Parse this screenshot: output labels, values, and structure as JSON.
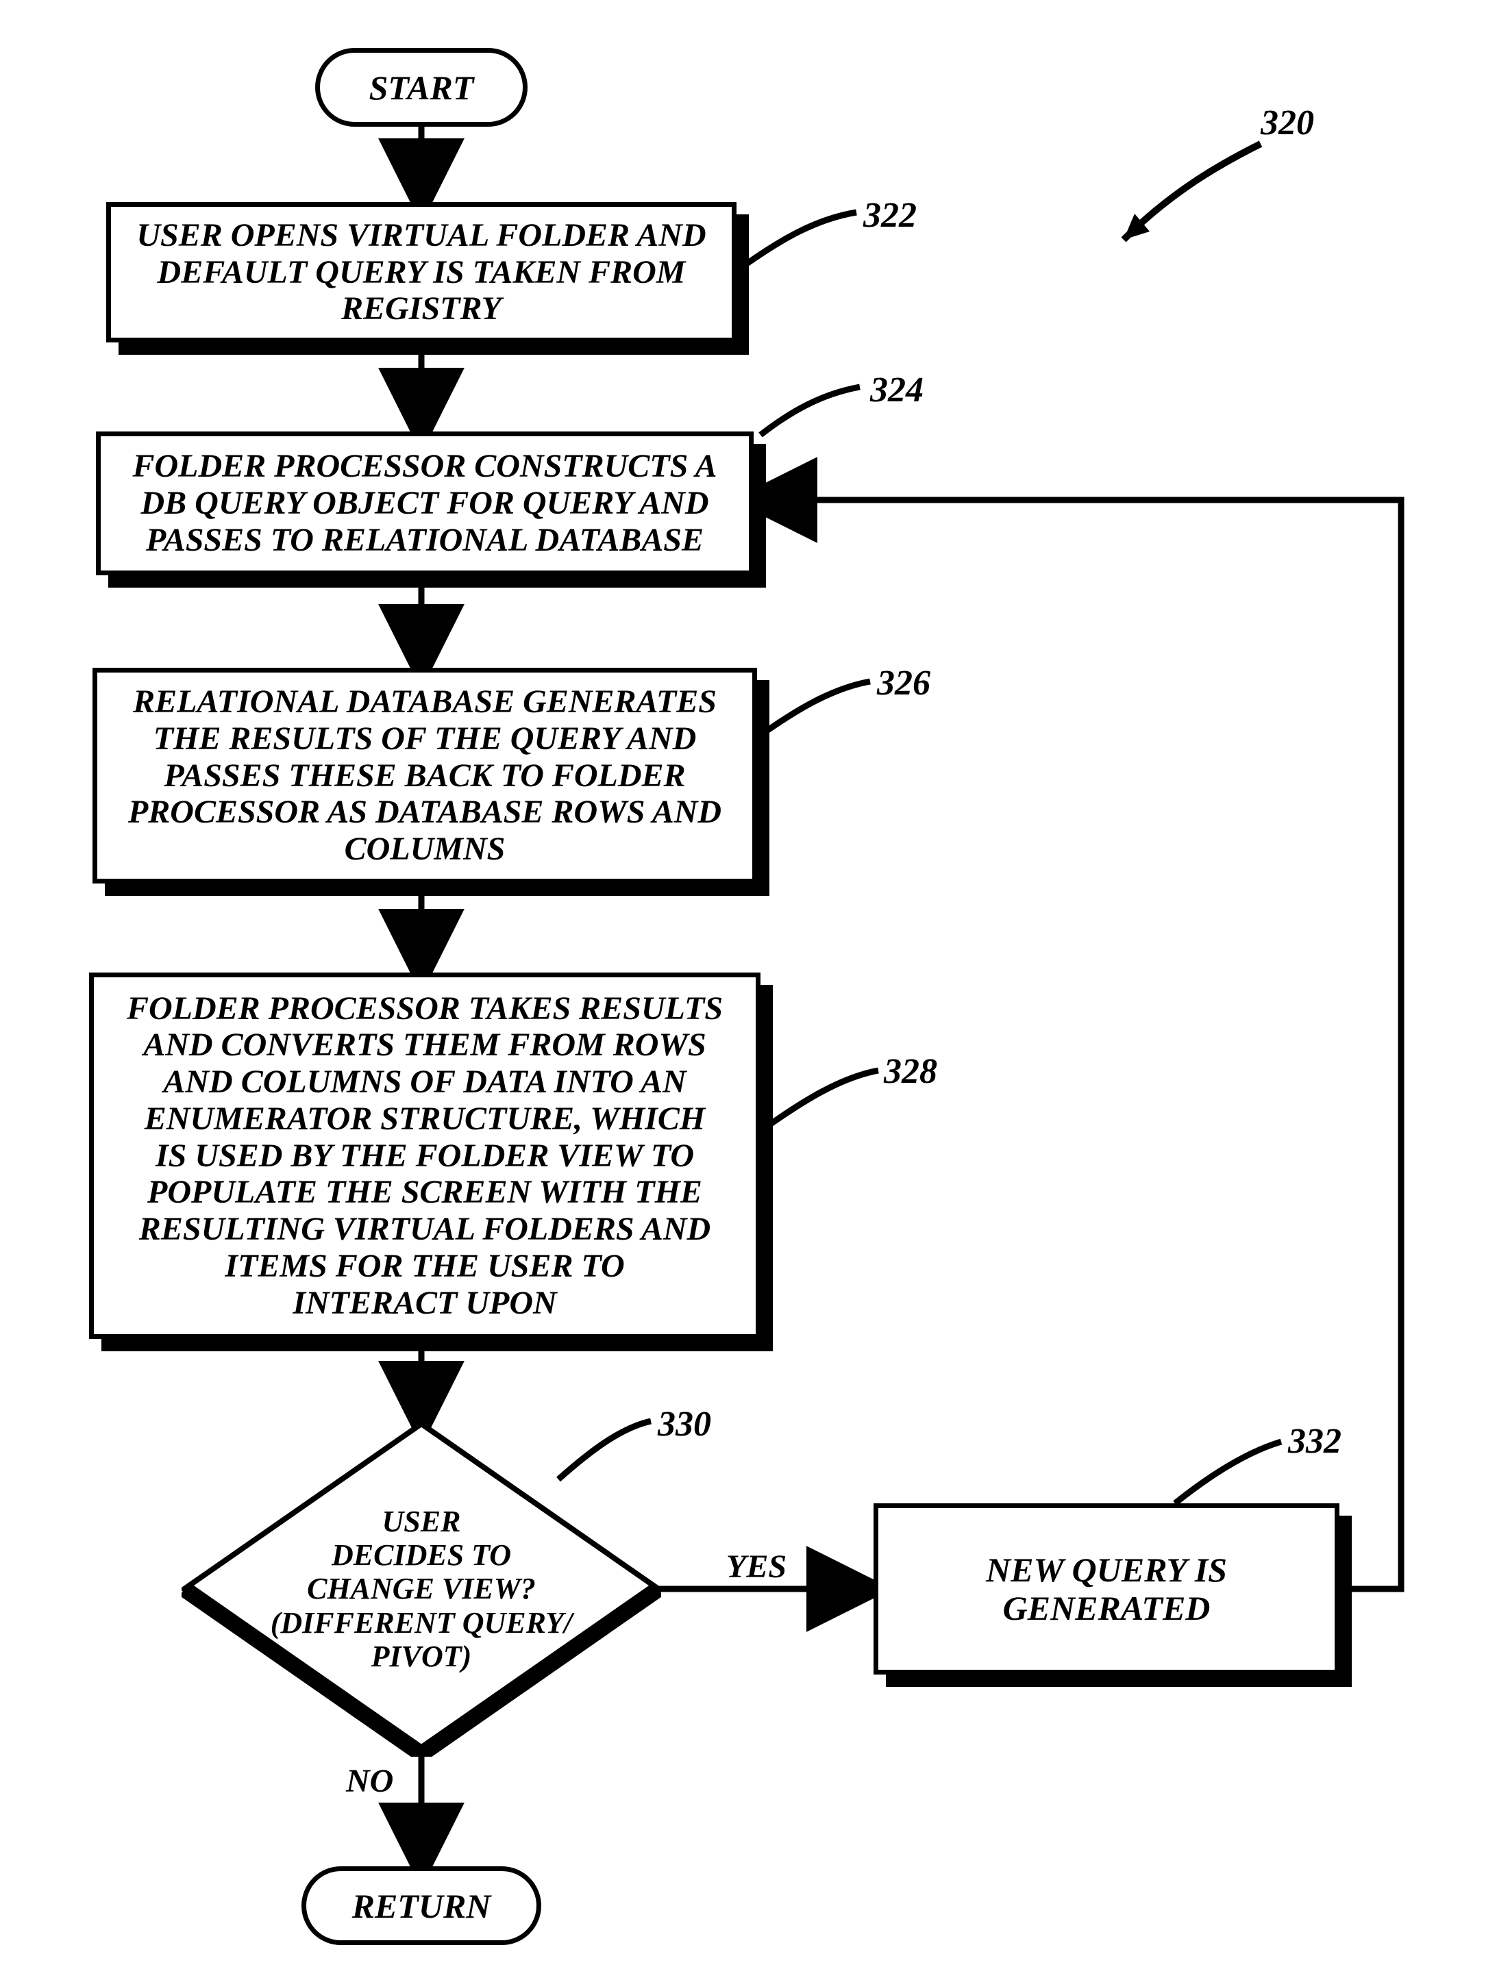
{
  "chart_data": {
    "type": "flowchart",
    "diagram_ref": "320",
    "nodes": [
      {
        "id": "start",
        "shape": "terminator",
        "text": "START"
      },
      {
        "id": "n322",
        "shape": "process",
        "ref": "322",
        "text": "USER OPENS VIRTUAL FOLDER AND DEFAULT QUERY IS TAKEN FROM REGISTRY"
      },
      {
        "id": "n324",
        "shape": "process",
        "ref": "324",
        "text": "FOLDER PROCESSOR CONSTRUCTS A DB QUERY OBJECT FOR QUERY AND PASSES TO RELATIONAL DATABASE"
      },
      {
        "id": "n326",
        "shape": "process",
        "ref": "326",
        "text": "RELATIONAL DATABASE GENERATES THE RESULTS OF THE QUERY AND PASSES THESE BACK TO FOLDER PROCESSOR AS DATABASE ROWS AND COLUMNS"
      },
      {
        "id": "n328",
        "shape": "process",
        "ref": "328",
        "text": "FOLDER PROCESSOR TAKES RESULTS AND CONVERTS THEM FROM ROWS AND COLUMNS OF DATA INTO AN ENUMERATOR STRUCTURE, WHICH IS USED BY THE FOLDER VIEW TO POPULATE THE SCREEN WITH THE RESULTING VIRTUAL FOLDERS AND ITEMS FOR THE USER TO INTERACT UPON"
      },
      {
        "id": "n330",
        "shape": "decision",
        "ref": "330",
        "text": "USER DECIDES TO CHANGE VIEW? (DIFFERENT QUERY/PIVOT)"
      },
      {
        "id": "n332",
        "shape": "process",
        "ref": "332",
        "text": "NEW QUERY IS GENERATED"
      },
      {
        "id": "return",
        "shape": "terminator",
        "text": "RETURN"
      }
    ],
    "edges": [
      {
        "from": "start",
        "to": "n322"
      },
      {
        "from": "n322",
        "to": "n324"
      },
      {
        "from": "n324",
        "to": "n326"
      },
      {
        "from": "n326",
        "to": "n328"
      },
      {
        "from": "n328",
        "to": "n330"
      },
      {
        "from": "n330",
        "to": "n332",
        "label": "YES"
      },
      {
        "from": "n330",
        "to": "return",
        "label": "NO"
      },
      {
        "from": "n332",
        "to": "n324"
      }
    ]
  },
  "nodes": {
    "start": {
      "text": "START"
    },
    "n322": {
      "text": "USER OPENS VIRTUAL FOLDER AND\nDEFAULT QUERY IS TAKEN FROM\nREGISTRY"
    },
    "n324": {
      "text": "FOLDER PROCESSOR CONSTRUCTS A\nDB QUERY OBJECT FOR QUERY AND\nPASSES TO RELATIONAL DATABASE"
    },
    "n326": {
      "text": "RELATIONAL DATABASE GENERATES\nTHE RESULTS OF THE QUERY AND\nPASSES THESE BACK TO FOLDER\nPROCESSOR AS DATABASE ROWS AND\nCOLUMNS"
    },
    "n328": {
      "text": "FOLDER PROCESSOR TAKES RESULTS\nAND CONVERTS THEM FROM ROWS\nAND COLUMNS OF DATA INTO AN\nENUMERATOR STRUCTURE, WHICH\nIS USED BY THE FOLDER VIEW TO\nPOPULATE THE SCREEN WITH THE\nRESULTING VIRTUAL FOLDERS AND\nITEMS FOR THE USER TO\nINTERACT UPON"
    },
    "n330": {
      "text": "USER\nDECIDES TO\nCHANGE VIEW?\n(DIFFERENT QUERY/\nPIVOT)"
    },
    "n332": {
      "text": "NEW QUERY IS\nGENERATED"
    },
    "return": {
      "text": "RETURN"
    }
  },
  "labels": {
    "yes": "YES",
    "no": "NO",
    "ref320": "320",
    "ref322": "322",
    "ref324": "324",
    "ref326": "326",
    "ref328": "328",
    "ref330": "330",
    "ref332": "332"
  }
}
